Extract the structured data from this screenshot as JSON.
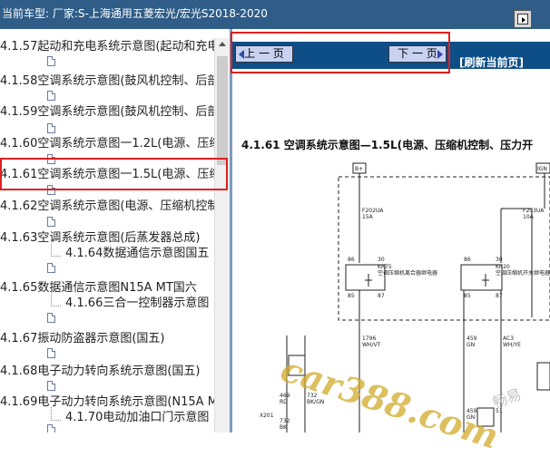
{
  "header": {
    "title": "当前车型:  厂家:S-上海通用五菱宏光/宏光S2018-2020"
  },
  "tree": {
    "items": [
      {
        "label": "4.1.57起动和充电系统示意图(起动和充电"
      },
      {
        "label": "4.1.58空调系统示意图(鼓风机控制、后部"
      },
      {
        "label": "4.1.59空调系统示意图(鼓风机控制、后部"
      },
      {
        "label": "4.1.60空调系统示意图一1.2L(电源、压缩"
      },
      {
        "label": "4.1.61空调系统示意图一1.5L(电源、压缩"
      },
      {
        "label": "4.1.62空调系统示意图(电源、压缩机控制"
      },
      {
        "label": "4.1.63空调系统示意图(后蒸发器总成)"
      },
      {
        "label": "4.1.64数据通信示意图国五"
      },
      {
        "label": "4.1.65数据通信示意图N15A MT国六"
      },
      {
        "label": "4.1.66三合一控制器示意图"
      },
      {
        "label": "4.1.67振动防盗器示意图(国五)"
      },
      {
        "label": "4.1.68电子动力转向系统示意图(国五)"
      },
      {
        "label": "4.1.69电子动力转向系统示意图(N15A M"
      },
      {
        "label": "4.1.70电动加油口门示意图"
      }
    ]
  },
  "nav": {
    "prev_label": "上 一 页",
    "next_label": "下 一 页",
    "refresh_label": "[刷新当前页]"
  },
  "document": {
    "title": "4.1.61  空调系统示意图—1.5L(电源、压缩机控制、压力开"
  },
  "diagram": {
    "labels": {
      "b_plus": "B+",
      "ign": "IGN",
      "fuse1": "F202UA",
      "fuse1_amp": "15A",
      "fuse2": "F203UA",
      "fuse2_amp": "10A",
      "relay1": "KR75",
      "relay1_desc": "空调压缩机离合器继电器",
      "relay2": "KR20",
      "relay2_desc": "空调压缩机开关继电器",
      "pin86a": "86",
      "pin30a": "30",
      "pin85a": "85",
      "pin87a": "87",
      "pin86b": "86",
      "pin30b": "30",
      "pin85b": "85",
      "pin87b": "87",
      "wire1": "1796",
      "wire1_color": "WH/VT",
      "wire2": "459",
      "wire2_color": "GN",
      "wire3": "AC3",
      "wire3_color": "WH/YE",
      "w469": "469",
      "w469c": "RD",
      "w732": "732",
      "w732c": "BK/GN",
      "x201": "X201",
      "w459b": "459",
      "w459bc": "GN",
      "w51": "51",
      "w732b": "732",
      "w732bc": "BK"
    }
  },
  "watermarks": {
    "main": "car388.com",
    "secondary": "畅易"
  },
  "colors": {
    "header_bg": "#2f5d88",
    "nav_bg": "#0e4e86",
    "highlight": "#e02020",
    "button_bg": "#c8d2f0"
  }
}
